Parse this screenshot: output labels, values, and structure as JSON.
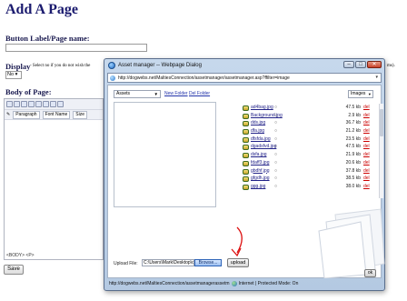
{
  "page": {
    "title": "Add A Page",
    "button_label": "Button Label/Page name:",
    "display_label": "Display",
    "display_hint": "- Select no if you do not wish the",
    "display_hint_tail": "ms).",
    "display_value": "No",
    "body_label": "Body of Page:",
    "editor": {
      "paragraph": "Paragraph",
      "font_name": "Font Name",
      "size": "Size",
      "status": "<BODY> <P>"
    },
    "save_label": "Save"
  },
  "dialog": {
    "title": "Asset manager -- Webpage Dialog",
    "address": "http://dogwebs.net/MaltiesConnection/assetmanager/assetmanager.asp?ffilter=image",
    "folder": "Assets",
    "new_folder": "New Folder",
    "del_folder": "Del Folder",
    "type_filter": "Images",
    "files": [
      {
        "name": "ad4bag.jpg",
        "size": "47.5 kb",
        "del": "del"
      },
      {
        "name": "Background.jpg",
        "size": "2.9 kb",
        "del": "del"
      },
      {
        "name": "dds.jpg",
        "size": "36.7 kb",
        "del": "del"
      },
      {
        "name": "dfa.jpg",
        "size": "21.2 kb",
        "del": "del"
      },
      {
        "name": "dfsfda.jpg",
        "size": "23.5 kb",
        "del": "del"
      },
      {
        "name": "dgadsfvd.jpg",
        "size": "47.5 kb",
        "del": "del"
      },
      {
        "name": "dsfa.jpg",
        "size": "21.9 kb",
        "del": "del"
      },
      {
        "name": "fdaff3.jpg",
        "size": "20.6 kb",
        "del": "del"
      },
      {
        "name": "gbdhf.jpg",
        "size": "37.8 kb",
        "del": "del"
      },
      {
        "name": "gfgdh.jpg",
        "size": "38.5 kb",
        "del": "del"
      },
      {
        "name": "ggg.jpg",
        "size": "38.0 kb",
        "del": "del"
      }
    ],
    "upload_label": "Upload File:",
    "upload_path": "C:\\Users\\Mark\\Desktop\\c",
    "browse_label": "Browse...",
    "upload_button": "upload",
    "ok_label": "ok",
    "status_url": "http://dogwebs.net/MaltiesConnection/assetmanagerassetm",
    "status_zone": "Internet | Protected Mode: On"
  },
  "colors": {
    "title": "#1a1a6e",
    "dialog_frame": "#b4c9e2",
    "link": "#2233aa",
    "delete": "#cc0000",
    "annotation_arrow": "#dd1111"
  }
}
